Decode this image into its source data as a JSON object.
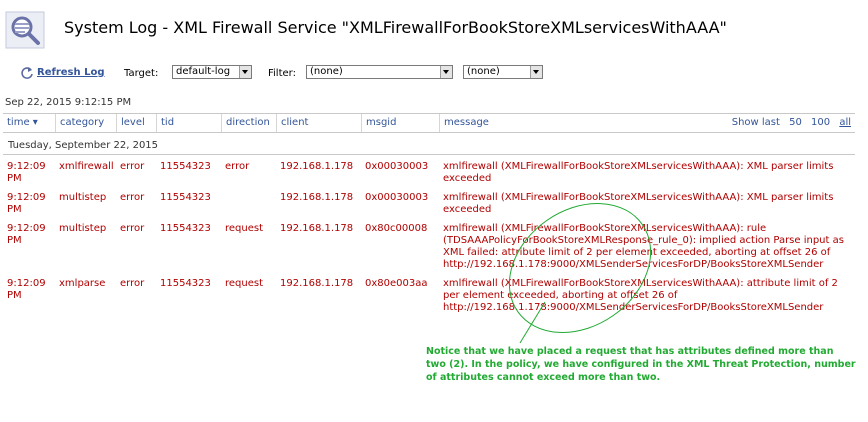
{
  "page": {
    "title": "System Log - XML Firewall Service \"XMLFirewallForBookStoreXMLservicesWithAAA\""
  },
  "toolbar": {
    "refresh_label": "Refresh Log",
    "target_label": "Target:",
    "target_value": "default-log",
    "filter_label": "Filter:",
    "filter_value": "(none)",
    "filter2_value": "(none)"
  },
  "timestamp": "Sep 22, 2015 9:12:15 PM",
  "table": {
    "columns": [
      "time ▾",
      "category",
      "level",
      "tid",
      "direction",
      "client",
      "msgid",
      "message"
    ],
    "show_last": {
      "label": "Show last",
      "options": [
        "50",
        "100",
        "all"
      ]
    },
    "date_group": "Tuesday, September 22, 2015",
    "rows": [
      {
        "time": "9:12:09 PM",
        "category": "xmlfirewall",
        "level": "error",
        "tid": "11554323",
        "direction": "error",
        "client": "192.168.1.178",
        "msgid": "0x00030003",
        "message": "xmlfirewall (XMLFirewallForBookStoreXMLservicesWithAAA): XML parser limits exceeded"
      },
      {
        "time": "9:12:09 PM",
        "category": "multistep",
        "level": "error",
        "tid": "11554323",
        "direction": "",
        "client": "192.168.1.178",
        "msgid": "0x00030003",
        "message": "xmlfirewall (XMLFirewallForBookStoreXMLservicesWithAAA): XML parser limits exceeded"
      },
      {
        "time": "9:12:09 PM",
        "category": "multistep",
        "level": "error",
        "tid": "11554323",
        "direction": "request",
        "client": "192.168.1.178",
        "msgid": "0x80c00008",
        "message": "xmlfirewall (XMLFirewallForBookStoreXMLservicesWithAAA): rule (TDSAAAPolicyForBookStoreXMLResponse_rule_0): implied action Parse input as XML failed: attribute limit of 2 per element exceeded, aborting at offset 26 of http://192.168.1.178:9000/XMLSenderServicesForDP/BooksStoreXMLSender"
      },
      {
        "time": "9:12:09 PM",
        "category": "xmlparse",
        "level": "error",
        "tid": "11554323",
        "direction": "request",
        "client": "192.168.1.178",
        "msgid": "0x80e003aa",
        "message": "xmlfirewall (XMLFirewallForBookStoreXMLservicesWithAAA): attribute limit of 2 per element exceeded, aborting at offset 26 of http://192.168.1.178:9000/XMLSenderServicesForDP/BooksStoreXMLSender"
      }
    ]
  },
  "annotation": {
    "note": "Notice that we have placed a request that has attributes defined more than two (2). In the policy, we have configured in the XML Threat Protection, number of attributes cannot exceed more than two."
  },
  "colors": {
    "error_text": "#b00000",
    "link": "#335599",
    "annotation": "#22aa33"
  }
}
